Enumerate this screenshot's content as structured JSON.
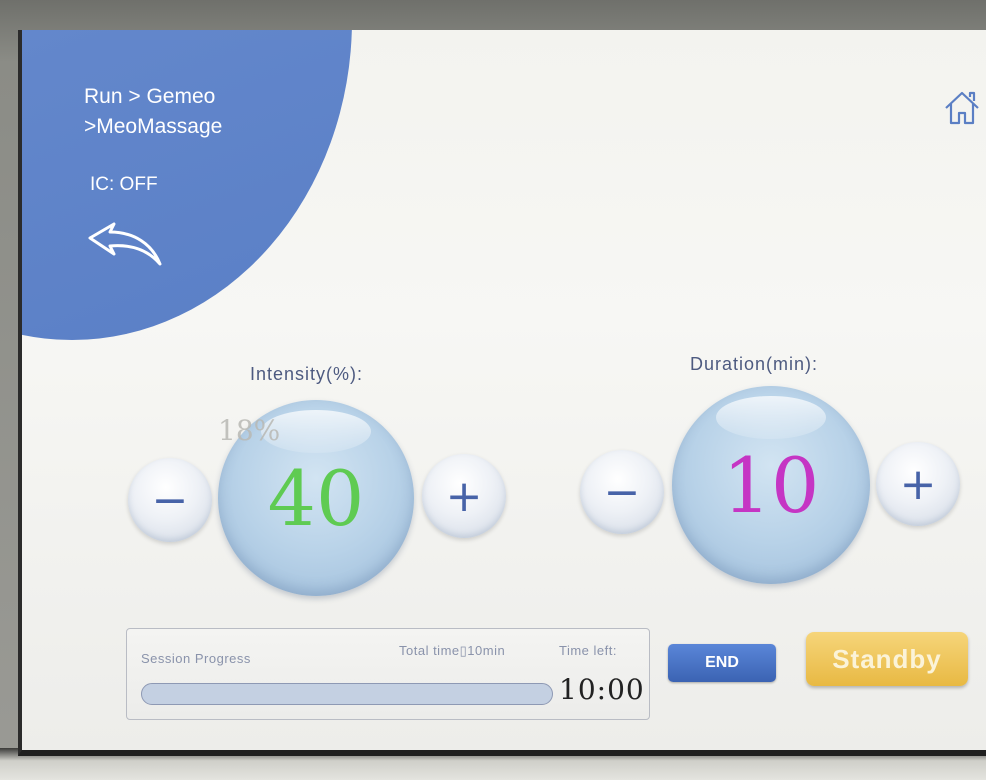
{
  "header": {
    "breadcrumb": "Run > Gemeo",
    "breadcrumb_sub": ">MeoMassage",
    "ic_status": "IC: OFF"
  },
  "icons": {
    "back": "back-arrow-icon",
    "home": "home-icon"
  },
  "intensity": {
    "label": "Intensity(%):",
    "value": "40",
    "ghost_value": "18%",
    "value_color": "#5fcb52",
    "minus": "−",
    "plus": "+"
  },
  "duration": {
    "label": "Duration(min):",
    "value": "10",
    "value_color": "#c535c4",
    "minus": "−",
    "plus": "+"
  },
  "session": {
    "title": "Session Progress",
    "total_time": "Total time▯10min",
    "time_left_label": "Time left:",
    "time_left": "10:00",
    "progress": 0
  },
  "buttons": {
    "end": "END",
    "standby": "Standby"
  },
  "colors": {
    "accent": "#5a7fc6",
    "standby": "#e8b943",
    "end": "#3b63b3"
  }
}
